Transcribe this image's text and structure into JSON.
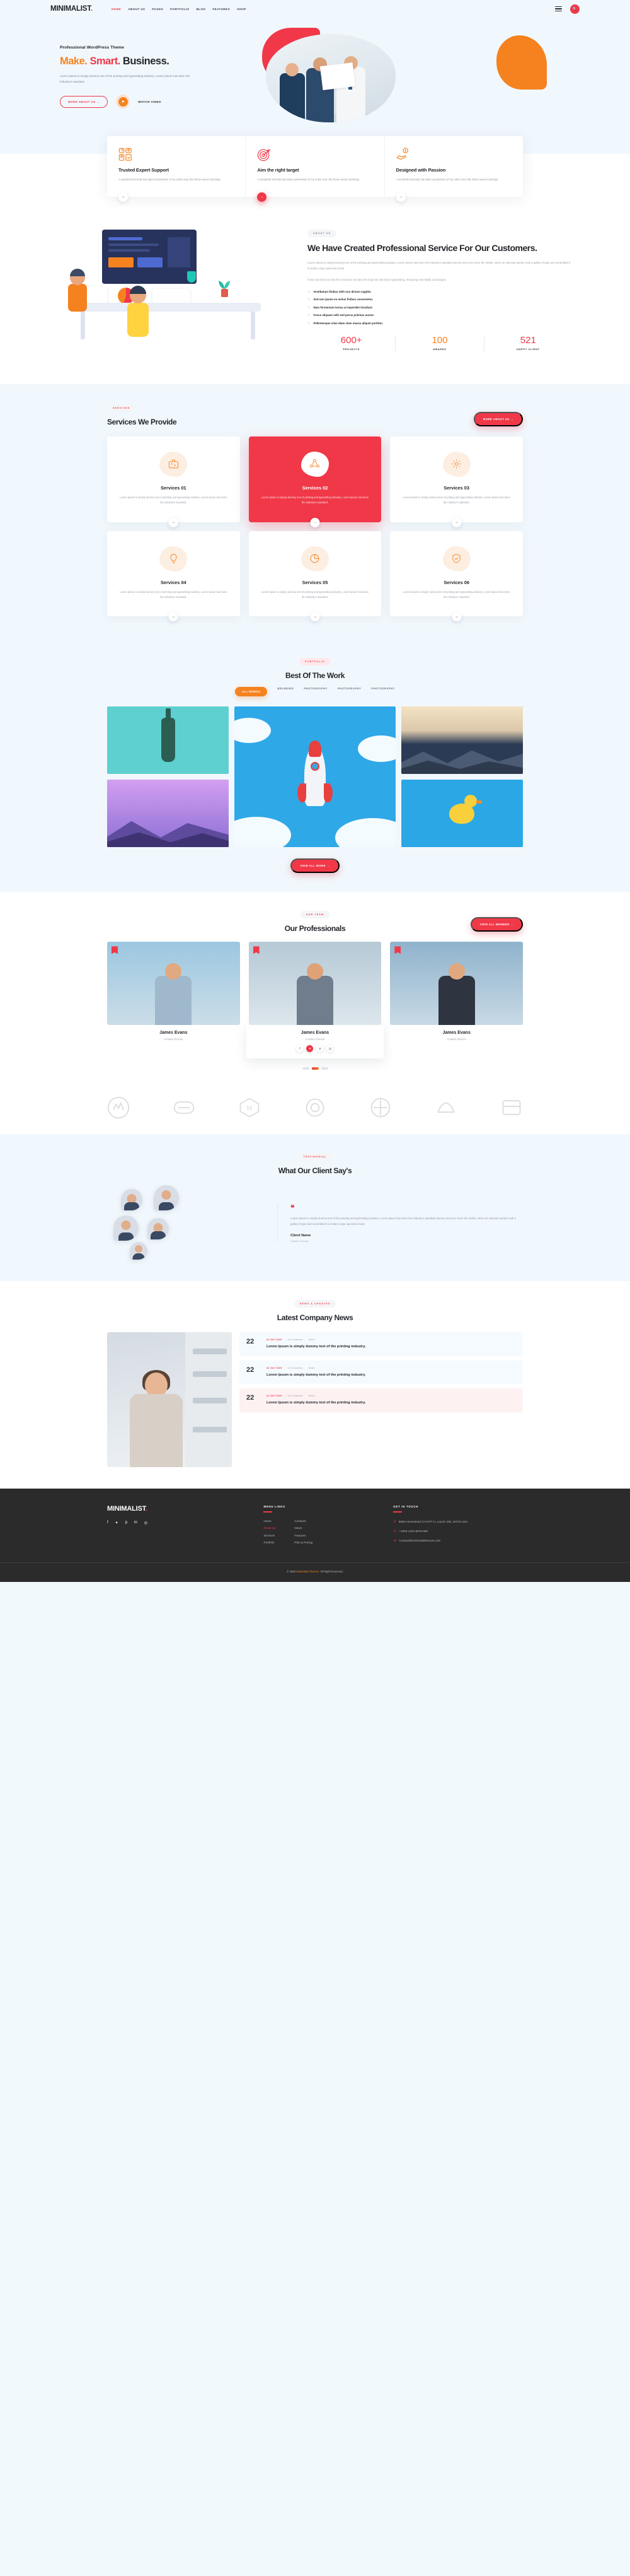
{
  "brand": {
    "name": "MINIMALIST",
    "dot": "."
  },
  "nav": {
    "items": [
      {
        "label": "HOME",
        "active": true
      },
      {
        "label": "ABOUT US",
        "active": false
      },
      {
        "label": "PAGES",
        "active": false
      },
      {
        "label": "PORTFOLIO",
        "active": false
      },
      {
        "label": "BLOG",
        "active": false
      },
      {
        "label": "FEATURES",
        "active": false
      },
      {
        "label": "SHOP",
        "active": false
      }
    ],
    "search_icon": "search-icon",
    "menu_icon": "hamburger-icon"
  },
  "hero": {
    "eyebrow": "Professional WordPress Theme",
    "title_1": "Make.",
    "title_2": "Smart.",
    "title_3": "Business.",
    "paragraph": "Lorem Ipsum is simply dummy text of the printing and typesetting industry. Lorem Ipsum has been the industry's standard.",
    "btn_primary": "MORE ABOUT US →",
    "btn_video": "WATCH VIDEO"
  },
  "features": [
    {
      "icon": "support-team-icon",
      "title": "Trusted Expert Support",
      "text": "A wonderful serenity has taken possession of my entire soul, like these sweet mornings.",
      "active": false
    },
    {
      "icon": "target-icon",
      "title": "Aim the right target",
      "text": "A wonderful serenity has taken possession of my entire soul, like these sweet mornings.",
      "active": true
    },
    {
      "icon": "hand-money-icon",
      "title": "Designed with Passion",
      "text": "A wonderful serenity has taken possession of my entire soul, like these sweet mornings.",
      "active": false
    }
  ],
  "about": {
    "badge": "ABOUT US",
    "title": "We Have Created Professional Service For Our Customers.",
    "p1": "Lorem Ipsum is simply dummy text of the printing and typesetting industry. Lorem Ipsum has been the industry's standard dummy text ever since the 1500s, when an unknown printer took a galley of type and scrambled it to make a type specimen book.",
    "p2": "It has survived not only five centuries, but also the leap into electronic typesetting, remaining essentially unchanged.",
    "ticks": [
      "Vestibulum finibus nibh non dictum sagittis.",
      "Sed non ipsum eu metus finibus consectetur.",
      "Nam fermentum lectus at imperdiet tincidunt.",
      "Fusce aliquam velit sed purus pulvinar auctor.",
      "Pellentesque vitae diam vitae massa aliquet porttitor."
    ],
    "counters": [
      {
        "value": "600+",
        "label": "PROJECTS",
        "color": "#f03848"
      },
      {
        "value": "100",
        "label": "AWARDS",
        "color": "#f5821f"
      },
      {
        "value": "521",
        "label": "HAPPY CLIENT",
        "color": "#f03848"
      }
    ]
  },
  "services": {
    "badge": "SERVICES",
    "title": "Services We Provide",
    "cta": "MORE ABOUT US →",
    "cards": [
      {
        "icon": "briefcase-icon",
        "title": "Services 01",
        "text": "Lorem Ipsum is simply dummy text of printing and typesetting industry. Lorem Ipsum has been the industry's standard.",
        "highlight": false
      },
      {
        "icon": "network-users-icon",
        "title": "Services 02",
        "text": "Lorem Ipsum is simply dummy text of printing and typesetting industry. Lorem Ipsum has been the industry's standard.",
        "highlight": true
      },
      {
        "icon": "settings-gear-icon",
        "title": "Services 03",
        "text": "Lorem Ipsum is simply dummy text of printing and typesetting industry. Lorem Ipsum has been the industry's standard.",
        "highlight": false
      },
      {
        "icon": "lightbulb-icon",
        "title": "Services 04",
        "text": "Lorem Ipsum is simply dummy text of printing and typesetting industry. Lorem Ipsum has been the industry's standard.",
        "highlight": false
      },
      {
        "icon": "pie-chart-icon",
        "title": "Services 05",
        "text": "Lorem Ipsum is simply dummy text of printing and typesetting industry. Lorem Ipsum has been the industry's standard.",
        "highlight": false
      },
      {
        "icon": "shield-check-icon",
        "title": "Services 06",
        "text": "Lorem Ipsum is simply dummy text of printing and typesetting industry. Lorem Ipsum has been the industry's standard.",
        "highlight": false
      }
    ]
  },
  "portfolio": {
    "badge": "PORTFOLIO",
    "title": "Best Of The Work",
    "filters": [
      {
        "label": "ALL WORKS",
        "active": true
      },
      {
        "label": "BRANDING",
        "active": false
      },
      {
        "label": "PHOTOGRAPHY",
        "active": false
      },
      {
        "label": "PHOTOGRAPHY",
        "active": false
      },
      {
        "label": "PHOTOGRAPHY",
        "active": false
      }
    ],
    "items": [
      {
        "name": "bottle-artwork",
        "color": "#5ed0cf"
      },
      {
        "name": "rocket-artwork",
        "color": "#2fa8e8"
      },
      {
        "name": "mountain-sunset-artwork",
        "color": "#2b3b55"
      },
      {
        "name": "purple-mountains-artwork",
        "color": "#8e76d8"
      },
      {
        "name": "rubber-duck-artwork",
        "color": "#2ca7e5"
      }
    ],
    "cta": "VIEW ALL WORK →"
  },
  "team": {
    "badge": "OUR TEAM",
    "title": "Our Professionals",
    "cta": "VIEW ALL MEMBER →",
    "members": [
      {
        "name": "James Evans",
        "role": "Creative Director",
        "featured": false
      },
      {
        "name": "James Evans",
        "role": "Creative Director",
        "featured": true
      },
      {
        "name": "James Evans",
        "role": "Creative Director",
        "featured": false
      }
    ],
    "social": [
      {
        "icon": "facebook-icon",
        "glyph": "f",
        "active": false
      },
      {
        "icon": "twitter-icon",
        "glyph": "✦",
        "active": true
      },
      {
        "icon": "pinterest-icon",
        "glyph": "p",
        "active": false
      },
      {
        "icon": "instagram-icon",
        "glyph": "◎",
        "active": false
      }
    ],
    "slider_dots": [
      false,
      true,
      false
    ]
  },
  "clients": {
    "logos": [
      "client-logo-1",
      "client-logo-2",
      "client-logo-3",
      "client-logo-4",
      "client-logo-5",
      "client-logo-6",
      "client-logo-7"
    ]
  },
  "testimonial": {
    "badge": "TESTIMONIAL",
    "title": "What Our Client Say's",
    "quote_mark": "❝",
    "quote": "Lorem Ipsum is simply dummy text of the printing and typesetting industry. Lorem Ipsum has been the industry's standard dummy text ever since the 1500s, when an unknown printer took a galley of type and scrambled it to make a type specimen book.",
    "client_name": "Client Name",
    "client_role": "Creative Director",
    "faces": [
      "client-face-1",
      "client-face-2",
      "client-face-3",
      "client-face-4",
      "client-face-5"
    ]
  },
  "news": {
    "badge": "NEWS & UPDATES",
    "title": "Latest Company News",
    "items": [
      {
        "date": "22",
        "meta_date": "22 JULY 2020",
        "comments": "04 Comments",
        "share": "Share",
        "title": "Lorem Ipsum is simply dummy text of the printing industry.",
        "tint": "blue"
      },
      {
        "date": "22",
        "meta_date": "22 JULY 2020",
        "comments": "04 Comments",
        "share": "Share",
        "title": "Lorem Ipsum is simply dummy text of the printing industry.",
        "tint": "blue"
      },
      {
        "date": "22",
        "meta_date": "22 JULY 2020",
        "comments": "04 Comments",
        "share": "Share",
        "title": "Lorem Ipsum is simply dummy text of the printing industry.",
        "tint": "pink"
      }
    ]
  },
  "footer": {
    "brand": "MINIMALIST",
    "dot": ".",
    "social": [
      {
        "icon": "facebook-icon",
        "glyph": "f"
      },
      {
        "icon": "twitter-icon",
        "glyph": "✦"
      },
      {
        "icon": "pinterest-icon",
        "glyph": "p"
      },
      {
        "icon": "linkedin-icon",
        "glyph": "in"
      },
      {
        "icon": "instagram-icon",
        "glyph": "◎"
      }
    ],
    "menu_heading": "MENU LINKS",
    "menu_col1": [
      {
        "label": "Home",
        "active": false
      },
      {
        "label": "About Us",
        "active": true
      },
      {
        "label": "Services",
        "active": false
      },
      {
        "label": "Portfolio",
        "active": false
      }
    ],
    "menu_col2": [
      {
        "label": "Contacts",
        "active": false
      },
      {
        "label": "News",
        "active": false
      },
      {
        "label": "Features",
        "active": false
      },
      {
        "label": "Plan & Pricing",
        "active": false
      }
    ],
    "contact_heading": "GET IN TOUCH",
    "contact": [
      {
        "icon": "location-pin-icon",
        "text": "9600 Homestead Ct #APT H, Laurel, MD, 20723 USA."
      },
      {
        "icon": "phone-icon",
        "text": "+1800-1234-5678-900"
      },
      {
        "icon": "mail-icon",
        "text": "Contact@minimalistthemes.com"
      }
    ],
    "copyright_pre": "© 2020 ",
    "copyright_brand": "Minimalist Themes.",
    "copyright_post": " All Right Reserved."
  },
  "colors": {
    "red": "#f03848",
    "orange": "#f5821f",
    "dark": "#2b2b2b",
    "pageBg": "#f1f8fd"
  }
}
